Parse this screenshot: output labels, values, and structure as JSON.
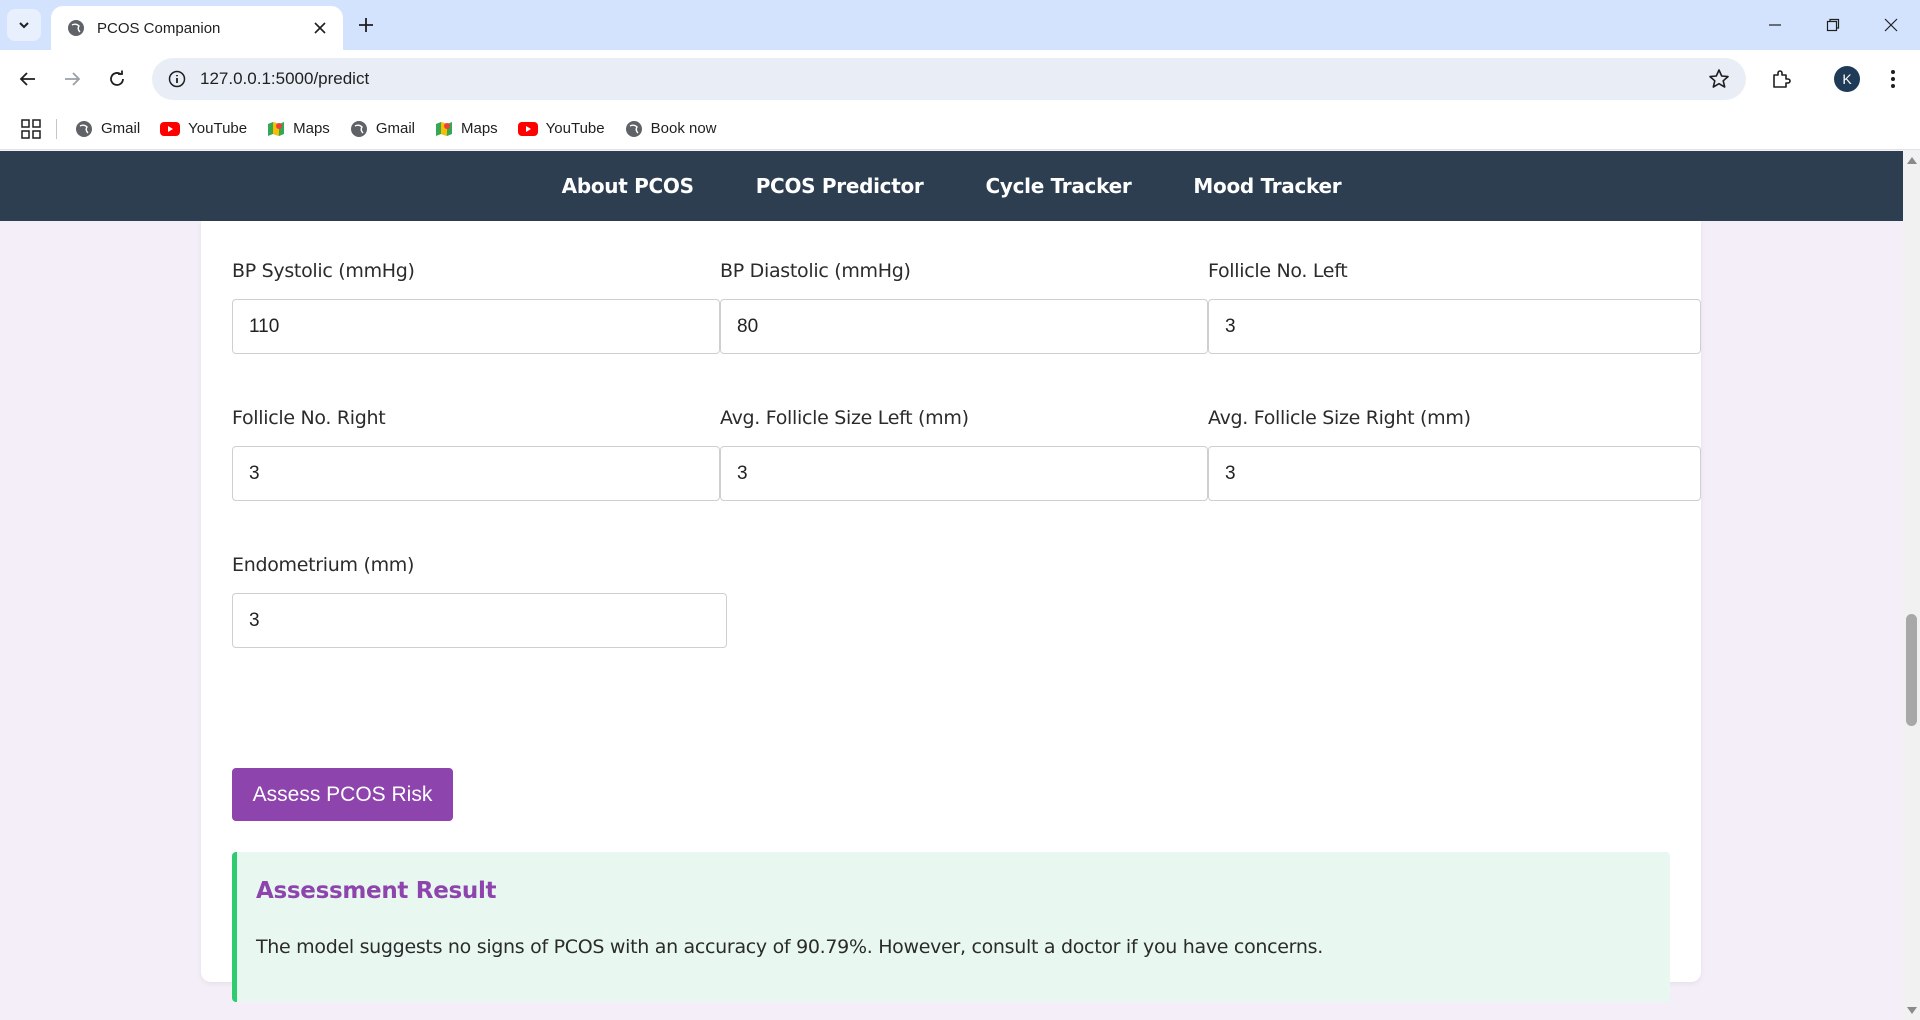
{
  "browser": {
    "tab_title": "PCOS Companion",
    "url": "127.0.0.1:5000/predict",
    "profile_initial": "K",
    "bookmarks": [
      {
        "label": "Gmail",
        "icon": "globe-icon"
      },
      {
        "label": "YouTube",
        "icon": "youtube-icon"
      },
      {
        "label": "Maps",
        "icon": "maps-icon"
      },
      {
        "label": "Gmail",
        "icon": "globe-icon"
      },
      {
        "label": "Maps",
        "icon": "maps-icon"
      },
      {
        "label": "YouTube",
        "icon": "youtube-icon"
      },
      {
        "label": "Book now",
        "icon": "globe-icon"
      }
    ]
  },
  "nav": {
    "links": [
      "About PCOS",
      "PCOS Predictor",
      "Cycle Tracker",
      "Mood Tracker"
    ]
  },
  "form": {
    "fields": [
      {
        "label": "BP Systolic (mmHg)",
        "value": "110"
      },
      {
        "label": "BP Diastolic (mmHg)",
        "value": "80"
      },
      {
        "label": "Follicle No. Left",
        "value": "3"
      },
      {
        "label": "Follicle No. Right",
        "value": "3"
      },
      {
        "label": "Avg. Follicle Size Left (mm)",
        "value": "3"
      },
      {
        "label": "Avg. Follicle Size Right (mm)",
        "value": "3"
      },
      {
        "label": "Endometrium (mm)",
        "value": "3"
      }
    ],
    "submit_label": "Assess PCOS Risk"
  },
  "result": {
    "title": "Assessment Result",
    "text": "The model suggests no signs of PCOS with an accuracy of 90.79%. However, consult a doctor if you have concerns."
  },
  "colors": {
    "navbar": "#2c3e50",
    "accent": "#8e44ad",
    "result_bg": "#e8f8f0",
    "result_border": "#2ecc71",
    "page_bg": "#f4eef9"
  }
}
